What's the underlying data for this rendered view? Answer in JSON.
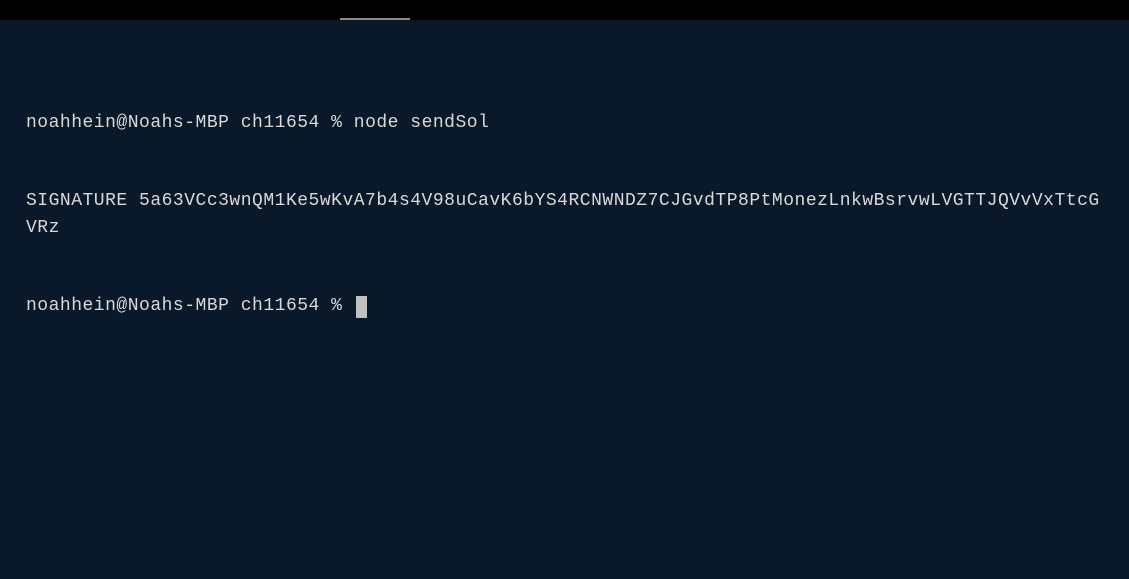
{
  "terminal": {
    "lines": [
      {
        "prompt": "noahhein@Noahs-MBP ch11654 % ",
        "command": "node sendSol"
      }
    ],
    "output": "SIGNATURE 5a63VCc3wnQM1Ke5wKvA7b4s4V98uCavK6bYS4RCNWNDZ7CJGvdTP8PtMonezLnkwBsrvwLVGTTJQVvVxTtcGVRz",
    "current_prompt": "noahhein@Noahs-MBP ch11654 % "
  }
}
